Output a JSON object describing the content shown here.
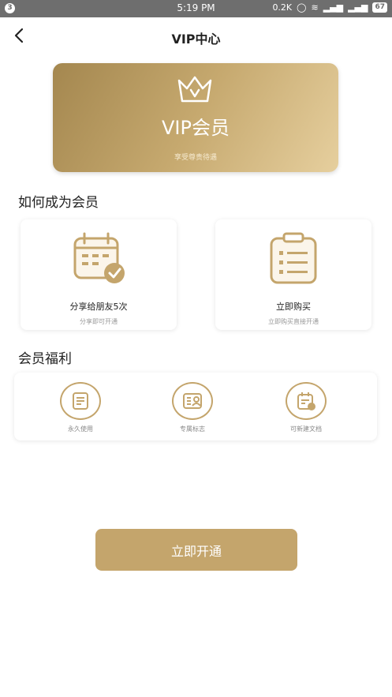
{
  "status_bar": {
    "left_icon": "3",
    "time": "5:19 PM",
    "speed": "0.2K",
    "battery": "67"
  },
  "nav": {
    "title": "VIP中心"
  },
  "vip_card": {
    "title": "VIP会员",
    "subtitle": "享受尊贵待遇"
  },
  "how_section": {
    "title": "如何成为会员",
    "cards": [
      {
        "title": "分享给朋友5次",
        "subtitle": "分享即可开通",
        "icon": "calendar-check-icon"
      },
      {
        "title": "立即购买",
        "subtitle": "立即购买直接开通",
        "icon": "clipboard-list-icon"
      }
    ]
  },
  "benefits_section": {
    "title": "会员福利",
    "items": [
      {
        "label": "永久使用",
        "icon": "document-icon"
      },
      {
        "label": "专属标志",
        "icon": "badge-icon"
      },
      {
        "label": "可新建文档",
        "icon": "new-document-icon"
      }
    ]
  },
  "cta": {
    "label": "立即开通"
  },
  "colors": {
    "gold": "#c4a56c",
    "gold_dark": "#a4874f",
    "gold_light": "#e6cf9e",
    "status_bar": "#6e6e6e"
  }
}
